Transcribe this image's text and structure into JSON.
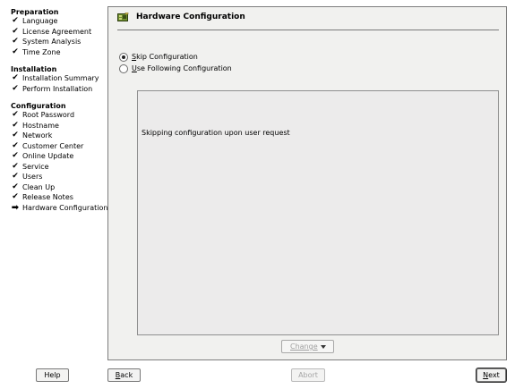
{
  "sidebar": {
    "sections": [
      {
        "title": "Preparation",
        "steps": [
          {
            "label": "Language",
            "status": "done"
          },
          {
            "label": "License Agreement",
            "status": "done"
          },
          {
            "label": "System Analysis",
            "status": "done"
          },
          {
            "label": "Time Zone",
            "status": "done"
          }
        ]
      },
      {
        "title": "Installation",
        "steps": [
          {
            "label": "Installation Summary",
            "status": "done"
          },
          {
            "label": "Perform Installation",
            "status": "done"
          }
        ]
      },
      {
        "title": "Configuration",
        "steps": [
          {
            "label": "Root Password",
            "status": "done"
          },
          {
            "label": "Hostname",
            "status": "done"
          },
          {
            "label": "Network",
            "status": "done"
          },
          {
            "label": "Customer Center",
            "status": "done"
          },
          {
            "label": "Online Update",
            "status": "done"
          },
          {
            "label": "Service",
            "status": "done"
          },
          {
            "label": "Users",
            "status": "done"
          },
          {
            "label": "Clean Up",
            "status": "done"
          },
          {
            "label": "Release Notes",
            "status": "done"
          },
          {
            "label": "Hardware Configuration",
            "status": "current"
          }
        ]
      }
    ],
    "icons": {
      "done": "check-icon",
      "current": "arrow-right-icon"
    }
  },
  "panel": {
    "title": "Hardware Configuration",
    "title_icon": "hardware-card-icon",
    "options": [
      {
        "label": "Skip Configuration",
        "mnemonic": "S",
        "rest": "kip Configuration",
        "selected": true
      },
      {
        "label": "Use Following Configuration",
        "mnemonic": "U",
        "rest": "se Following Configuration",
        "selected": false
      }
    ],
    "content_text": "Skipping configuration upon user request",
    "change_button": {
      "label": "Change",
      "enabled": false
    }
  },
  "buttons": {
    "help": "Help",
    "back": {
      "mnemonic": "B",
      "rest": "ack"
    },
    "abort": "Abort",
    "next": {
      "mnemonic": "N",
      "rest": "ext"
    }
  },
  "colors": {
    "panel_bg": "#f1f1ef",
    "content_bg": "#ecebeb",
    "disabled_text": "#a5a5a5"
  }
}
